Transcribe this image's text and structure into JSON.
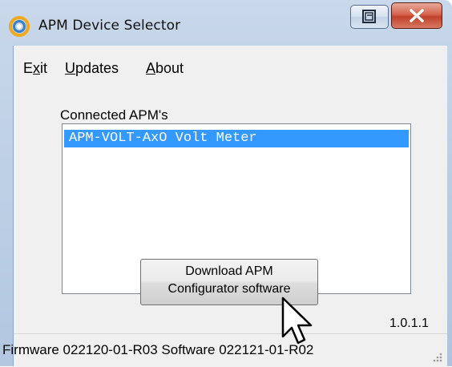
{
  "window": {
    "title": "APM Device Selector"
  },
  "menu": {
    "exit_pre": "E",
    "exit_ul": "x",
    "exit_post": "it",
    "updates_ul": "U",
    "updates_post": "pdates",
    "about_ul": "A",
    "about_post": "bout"
  },
  "main": {
    "connected_label": "Connected APM's",
    "devices": [
      "APM-VOLT-AxO Volt Meter"
    ],
    "download_button": [
      "Download APM",
      "Configurator software"
    ],
    "version": "1.0.1.1"
  },
  "status": {
    "text": "Firmware 022120-01-R03  Software 022121-01-R02"
  },
  "colors": {
    "selection": "#3399ff",
    "close_button": "#c2412b"
  }
}
